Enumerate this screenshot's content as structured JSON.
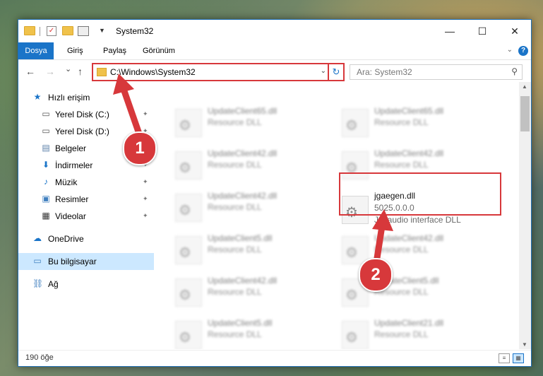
{
  "window": {
    "title": "System32",
    "minimize": "—",
    "maximize": "☐",
    "close": "✕"
  },
  "ribbon": {
    "tabs": [
      "Dosya",
      "Giriş",
      "Paylaş",
      "Görünüm"
    ],
    "expand": "⌄",
    "help": "?"
  },
  "nav": {
    "back": "←",
    "forward": "→",
    "recent": "⌄",
    "up": "↑",
    "address": "C:\\Windows\\System32",
    "address_dropdown": "⌄",
    "refresh": "↻",
    "search_placeholder": "Ara: System32",
    "search_icon": "⚲"
  },
  "sidebar": {
    "items": [
      {
        "label": "Hızlı erişim",
        "icon": "star-icon",
        "glyph": "★",
        "color": "#1a74c8",
        "pinned": false
      },
      {
        "label": "Yerel Disk (C:)",
        "icon": "drive-icon",
        "glyph": "▭",
        "color": "#555",
        "pinned": true
      },
      {
        "label": "Yerel Disk (D:)",
        "icon": "drive-icon",
        "glyph": "▭",
        "color": "#555",
        "pinned": true
      },
      {
        "label": "Belgeler",
        "icon": "documents-icon",
        "glyph": "▤",
        "color": "#5a7fa8",
        "pinned": true
      },
      {
        "label": "İndirmeler",
        "icon": "download-icon",
        "glyph": "⬇",
        "color": "#1a74c8",
        "pinned": true
      },
      {
        "label": "Müzik",
        "icon": "music-icon",
        "glyph": "♪",
        "color": "#1a74c8",
        "pinned": true
      },
      {
        "label": "Resimler",
        "icon": "pictures-icon",
        "glyph": "▣",
        "color": "#3f7fbf",
        "pinned": true
      },
      {
        "label": "Videolar",
        "icon": "video-icon",
        "glyph": "▦",
        "color": "#333",
        "pinned": true
      },
      {
        "label": "OneDrive",
        "icon": "cloud-icon",
        "glyph": "☁",
        "color": "#1a74c8",
        "pinned": false
      },
      {
        "label": "Bu bilgisayar",
        "icon": "computer-icon",
        "glyph": "▭",
        "color": "#3f7fbf",
        "pinned": false
      },
      {
        "label": "Ağ",
        "icon": "network-icon",
        "glyph": "⛓",
        "color": "#3f7fbf",
        "pinned": false
      }
    ],
    "pin_glyph": "📌"
  },
  "files": [
    {
      "name": "UpdateClient65.dll",
      "desc": "Resource DLL"
    },
    {
      "name": "UpdateClient65.dll",
      "desc": "Resource DLL"
    },
    {
      "name": "UpdateClient42.dll",
      "desc": "Resource DLL"
    },
    {
      "name": "UpdateClient42.dll",
      "desc": "Resource DLL"
    },
    {
      "name": "UpdateClient42.dll",
      "desc": "Resource DLL"
    },
    {
      "name": "jgaegen.dll",
      "version": "5025.0.0.0",
      "desc": "JG audio interface DLL"
    },
    {
      "name": "UpdateClient5.dll",
      "desc": "Resource DLL"
    },
    {
      "name": "UpdateClient42.dll",
      "desc": "Resource DLL"
    },
    {
      "name": "UpdateClient42.dll",
      "desc": "Resource DLL"
    },
    {
      "name": "UpdateClient5.dll",
      "desc": "Resource DLL"
    },
    {
      "name": "UpdateClient5.dll",
      "desc": "Resource DLL"
    },
    {
      "name": "UpdateClient21.dll",
      "desc": "Resource DLL"
    }
  ],
  "status": {
    "count": "190 öğe"
  },
  "annotations": {
    "step1": "1",
    "step2": "2",
    "color": "#d7383b"
  }
}
